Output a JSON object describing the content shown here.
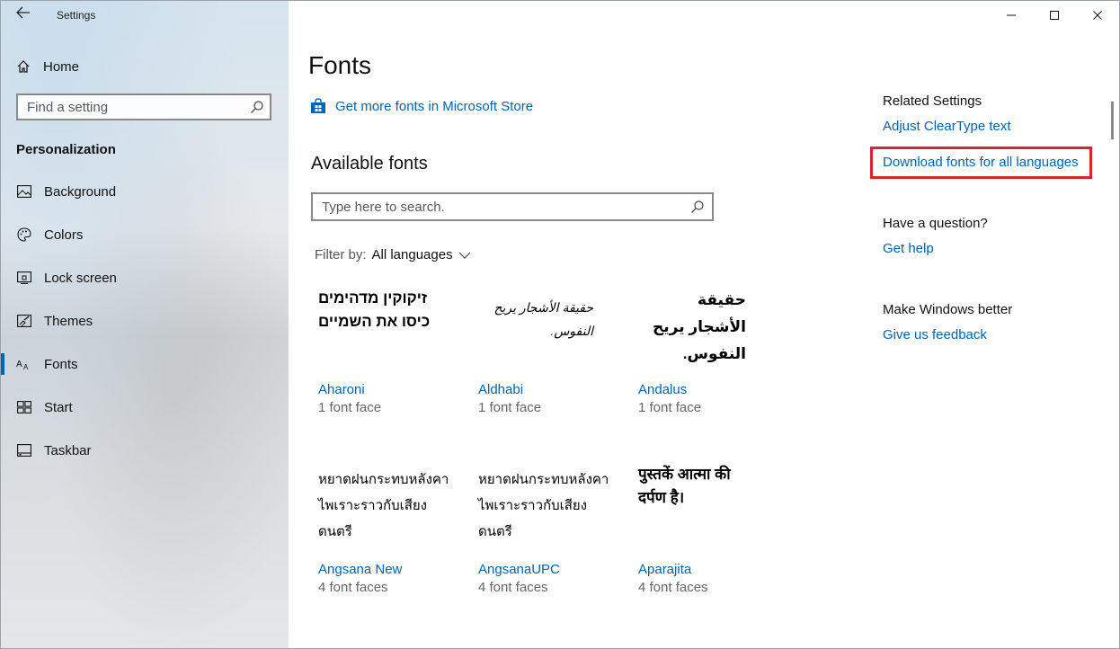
{
  "window": {
    "title": "Settings",
    "controls": {
      "minimize": "minimize-icon",
      "maximize": "maximize-icon",
      "close": "close-icon"
    }
  },
  "sidebar": {
    "home_label": "Home",
    "search_placeholder": "Find a setting",
    "section_label": "Personalization",
    "items": [
      {
        "label": "Background",
        "icon": "picture-icon"
      },
      {
        "label": "Colors",
        "icon": "palette-icon"
      },
      {
        "label": "Lock screen",
        "icon": "lock-screen-icon"
      },
      {
        "label": "Themes",
        "icon": "brush-icon"
      },
      {
        "label": "Fonts",
        "icon": "font-icon",
        "active": true
      },
      {
        "label": "Start",
        "icon": "start-icon"
      },
      {
        "label": "Taskbar",
        "icon": "taskbar-icon"
      }
    ]
  },
  "main": {
    "title": "Fonts",
    "store_link": "Get more fonts in Microsoft Store",
    "available_heading": "Available fonts",
    "search_placeholder": "Type here to search.",
    "filter_label": "Filter by:",
    "filter_value": "All languages",
    "fonts": [
      {
        "preview": "זיקוקין מדהימים כיסו את השמיים",
        "name": "Aharoni",
        "faces": "1 font face"
      },
      {
        "preview": "حقيقة الأشجار يريح النفوس.",
        "name": "Aldhabi",
        "faces": "1 font face"
      },
      {
        "preview": "حقيقة الأشجار يريح النفوس.",
        "name": "Andalus",
        "faces": "1 font face"
      },
      {
        "preview": "หยาดฝนกระทบหลังคา ไพเราะราวกับเสียงดนตรี",
        "name": "Angsana New",
        "faces": "4 font faces"
      },
      {
        "preview": "หยาดฝนกระทบหลังคา ไพเราะราวกับเสียงดนตรี",
        "name": "AngsanaUPC",
        "faces": "4 font faces"
      },
      {
        "preview": "पुस्तकें आत्मा की दर्पण है।",
        "name": "Aparajita",
        "faces": "4 font faces"
      }
    ]
  },
  "related": {
    "heading": "Related Settings",
    "cleartype": "Adjust ClearType text",
    "download": "Download fonts for all languages",
    "question_heading": "Have a question?",
    "get_help": "Get help",
    "better_heading": "Make Windows better",
    "feedback": "Give us feedback"
  },
  "colors": {
    "accent": "#0063b1",
    "highlight": "#d8242e"
  }
}
